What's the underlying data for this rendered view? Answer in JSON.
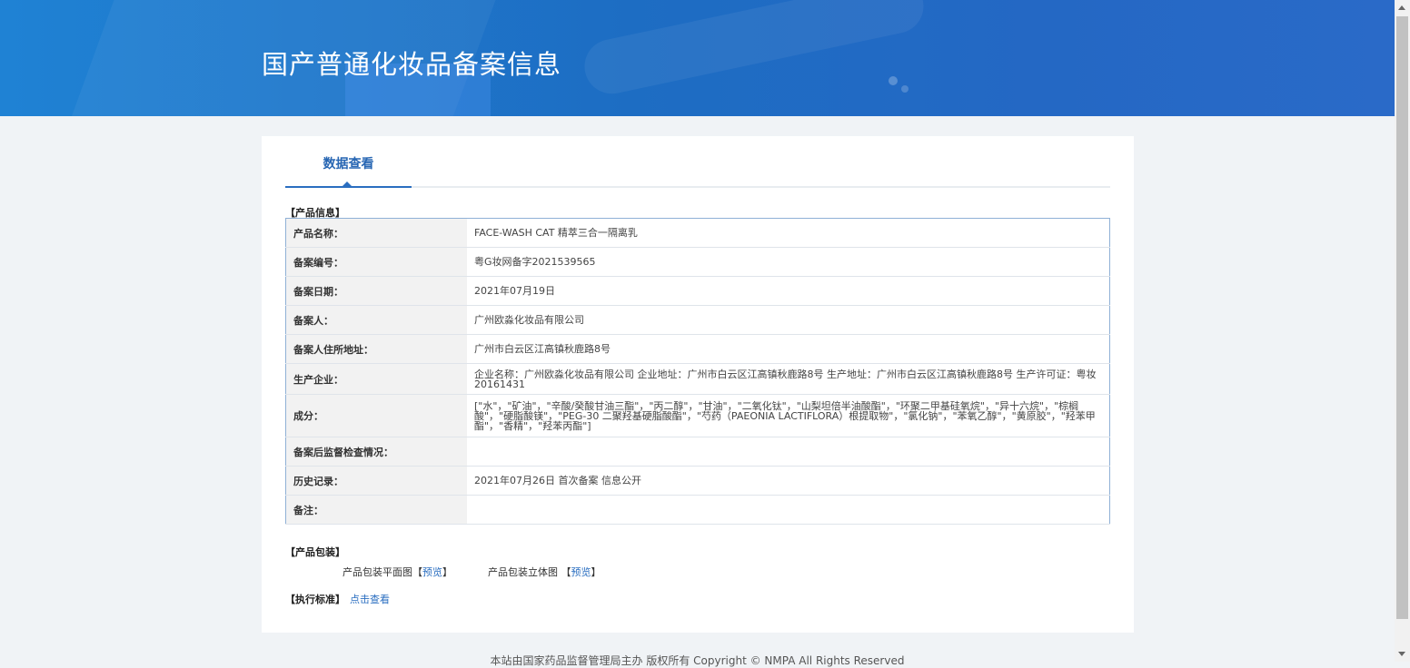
{
  "header": {
    "title": "国产普通化妆品备案信息"
  },
  "tabs": [
    {
      "label": "数据查看"
    }
  ],
  "product_info": {
    "section_title": "【产品信息】",
    "rows": [
      {
        "label": "产品名称：",
        "value": "FACE-WASH CAT 精萃三合一隔离乳"
      },
      {
        "label": "备案编号：",
        "value": "粤G妆网备字2021539565"
      },
      {
        "label": "备案日期：",
        "value": "2021年07月19日"
      },
      {
        "label": "备案人：",
        "value": "广州欧淼化妆品有限公司"
      },
      {
        "label": "备案人住所地址：",
        "value": "广州市白云区江高镇秋鹿路8号"
      },
      {
        "label": "生产企业：",
        "value": "企业名称：广州欧淼化妆品有限公司 企业地址：广州市白云区江高镇秋鹿路8号 生产地址：广州市白云区江高镇秋鹿路8号 生产许可证：粤妆20161431"
      },
      {
        "label": "成分：",
        "value": "[\"水\"，\"矿油\"，\"辛酸/癸酸甘油三酯\"，\"丙二醇\"，\"甘油\"，\"二氧化钛\"，\"山梨坦倍半油酸酯\"，\"环聚二甲基硅氧烷\"，\"异十六烷\"，\"棕榈酸\"，\"硬脂酸镁\"，\"PEG-30 二聚羟基硬脂酸酯\"，\"芍药（PAEONIA LACTIFLORA）根提取物\"，\"氯化钠\"，\"苯氧乙醇\"，\"黄原胶\"，\"羟苯甲酯\"，\"香精\"，\"羟苯丙酯\"]"
      },
      {
        "label": "备案后监督检查情况：",
        "value": ""
      },
      {
        "label": "历史记录：",
        "value": "2021年07月26日 首次备案 信息公开"
      },
      {
        "label": "备注：",
        "value": ""
      }
    ]
  },
  "packaging": {
    "section_title": "【产品包装】",
    "flat_label": "产品包装平面图",
    "solid_label": "产品包装立体图",
    "preview_text": "预览",
    "bracket_open": "【",
    "bracket_close": "】"
  },
  "standard": {
    "section_title": "【执行标准】",
    "link": "点击查看"
  },
  "footer": {
    "text": "本站由国家药品监督管理局主办 版权所有 Copyright © NMPA All Rights Reserved"
  }
}
